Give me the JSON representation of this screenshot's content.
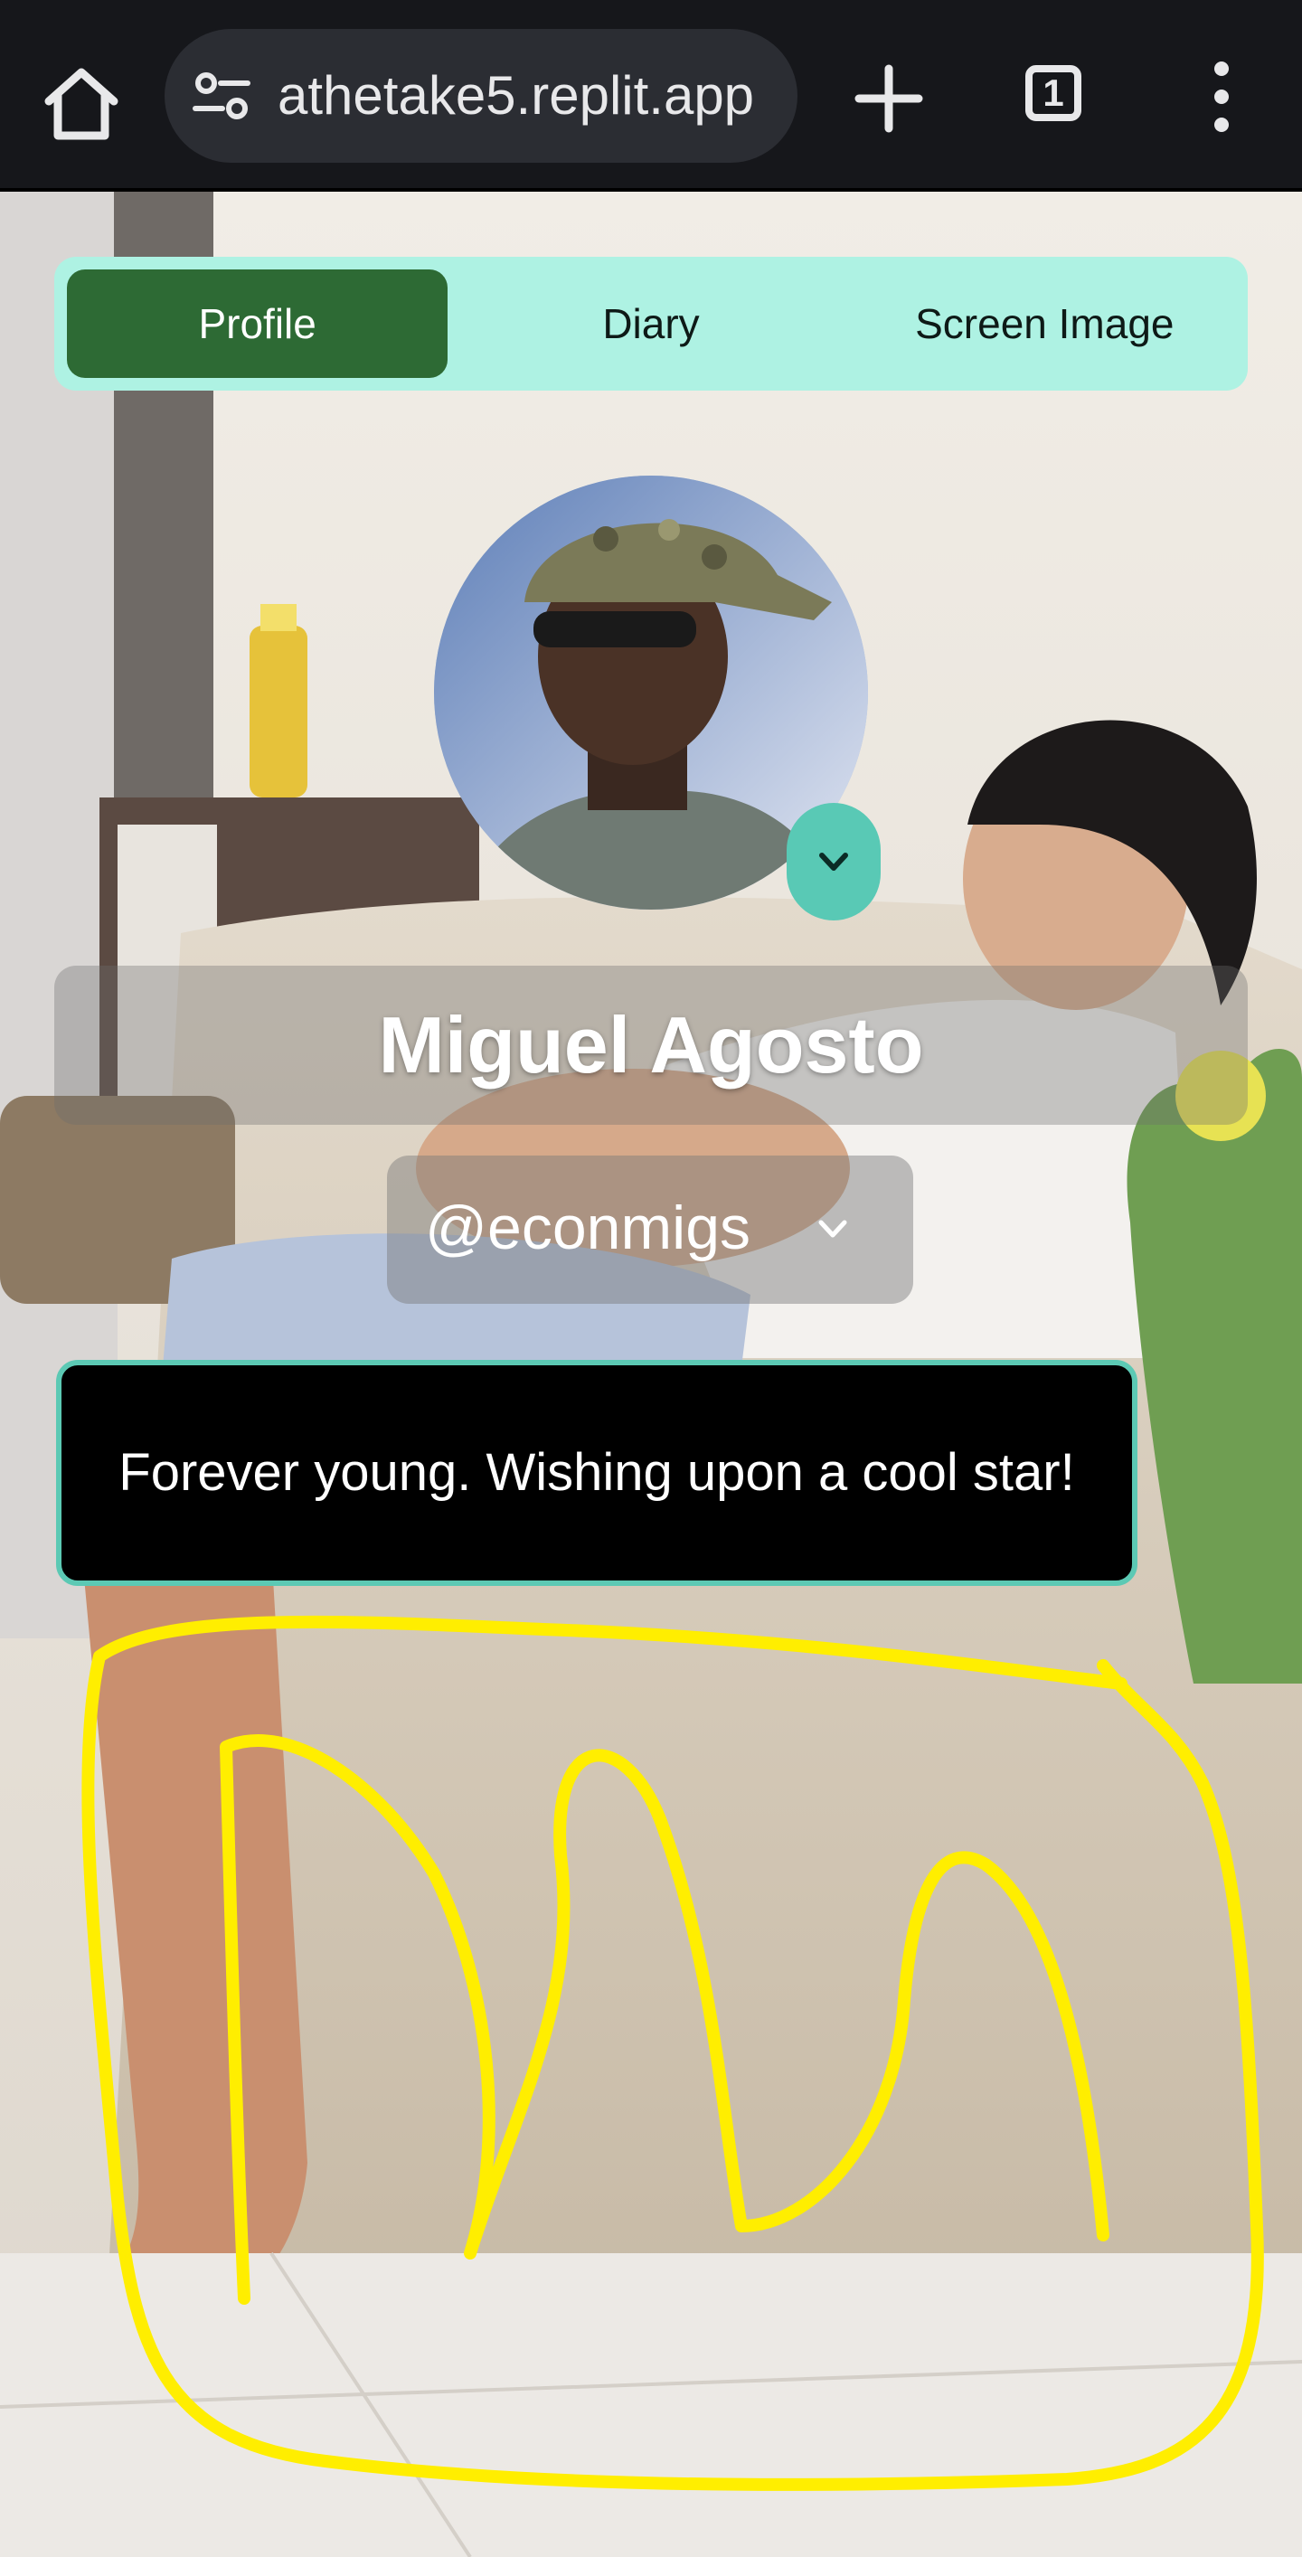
{
  "browser": {
    "url": "athetake5.replit.app",
    "tab_count": "1",
    "icons": {
      "home": "home-icon",
      "site_info": "site-settings-icon",
      "new_tab": "plus-icon",
      "tab_switcher": "tab-count-icon",
      "menu": "more-vertical-icon"
    }
  },
  "tabs": [
    {
      "label": "Profile",
      "active": true
    },
    {
      "label": "Diary",
      "active": false
    },
    {
      "label": "Screen Image",
      "active": false
    }
  ],
  "profile": {
    "name": "Miguel Agosto",
    "handle": "@econmigs",
    "bio": "Forever young. Wishing upon a cool star!",
    "avatar_toggle_icon": "chevron-down-icon",
    "handle_menu_icon": "chevron-down-icon"
  },
  "colors": {
    "tab_bar_bg": "#aef2e3",
    "active_tab": "#2d6a34",
    "accent_teal": "#59c9b5",
    "bio_border": "#5cc9b4",
    "scribble": "#ffee00"
  }
}
